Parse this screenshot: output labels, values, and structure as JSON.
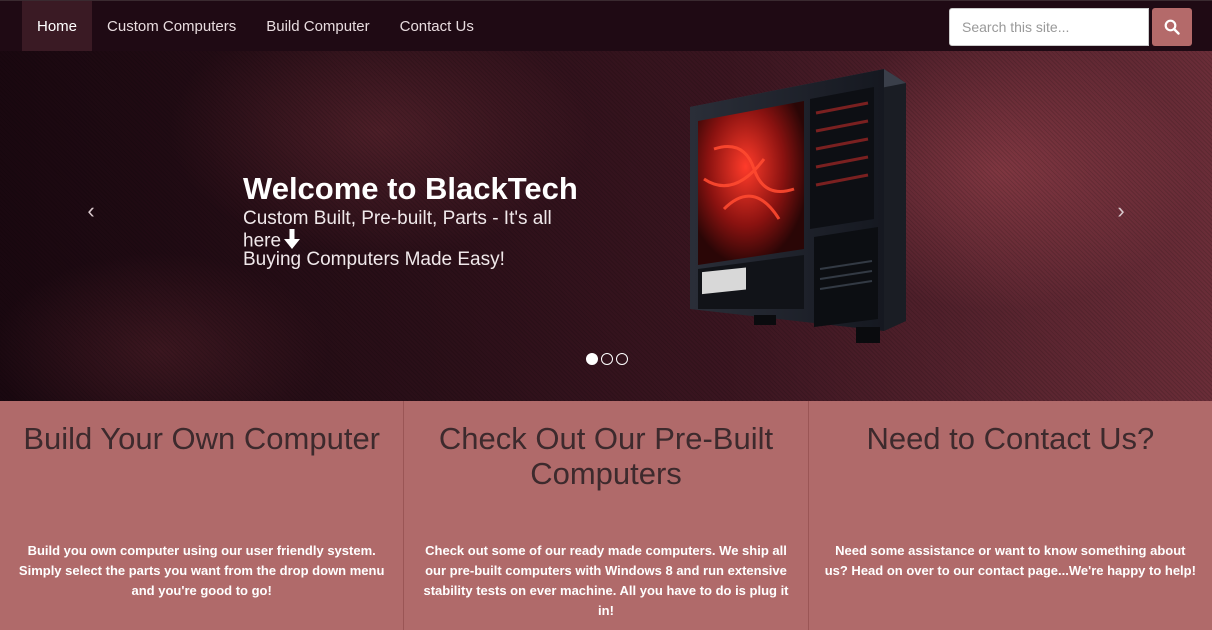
{
  "nav": {
    "items": [
      {
        "label": "Home",
        "active": true
      },
      {
        "label": "Custom Computers",
        "active": false
      },
      {
        "label": "Build Computer",
        "active": false
      },
      {
        "label": "Contact Us",
        "active": false
      }
    ],
    "search_placeholder": "Search this site...",
    "search_icon": "search-icon"
  },
  "hero": {
    "title": "Welcome to BlackTech",
    "subtitle": "Custom Built, Pre-built, Parts - It's all here",
    "tagline": "Buying Computers Made Easy!",
    "prev_glyph": "‹",
    "next_glyph": "›",
    "slide_count": 3,
    "active_slide": 1
  },
  "features": [
    {
      "title": "Build Your Own Computer",
      "body": "Build you own computer using our user friendly system. Simply select the parts you want from the drop down menu and you're good to go!"
    },
    {
      "title": "Check Out Our Pre-Built Computers",
      "body": "Check out some of our ready made computers. We ship all our pre-built computers with Windows 8 and run extensive stability tests on ever machine. All you have to do is plug it in!"
    },
    {
      "title": "Need to Contact Us?",
      "body": "Need some assistance or want to know something about us? Head on over to our contact page...We're happy to help!"
    }
  ],
  "colors": {
    "nav_bg": "#1f0a14",
    "nav_active": "#3a1a24",
    "accent": "#b46a6a",
    "features_bg": "#b06a6a"
  }
}
